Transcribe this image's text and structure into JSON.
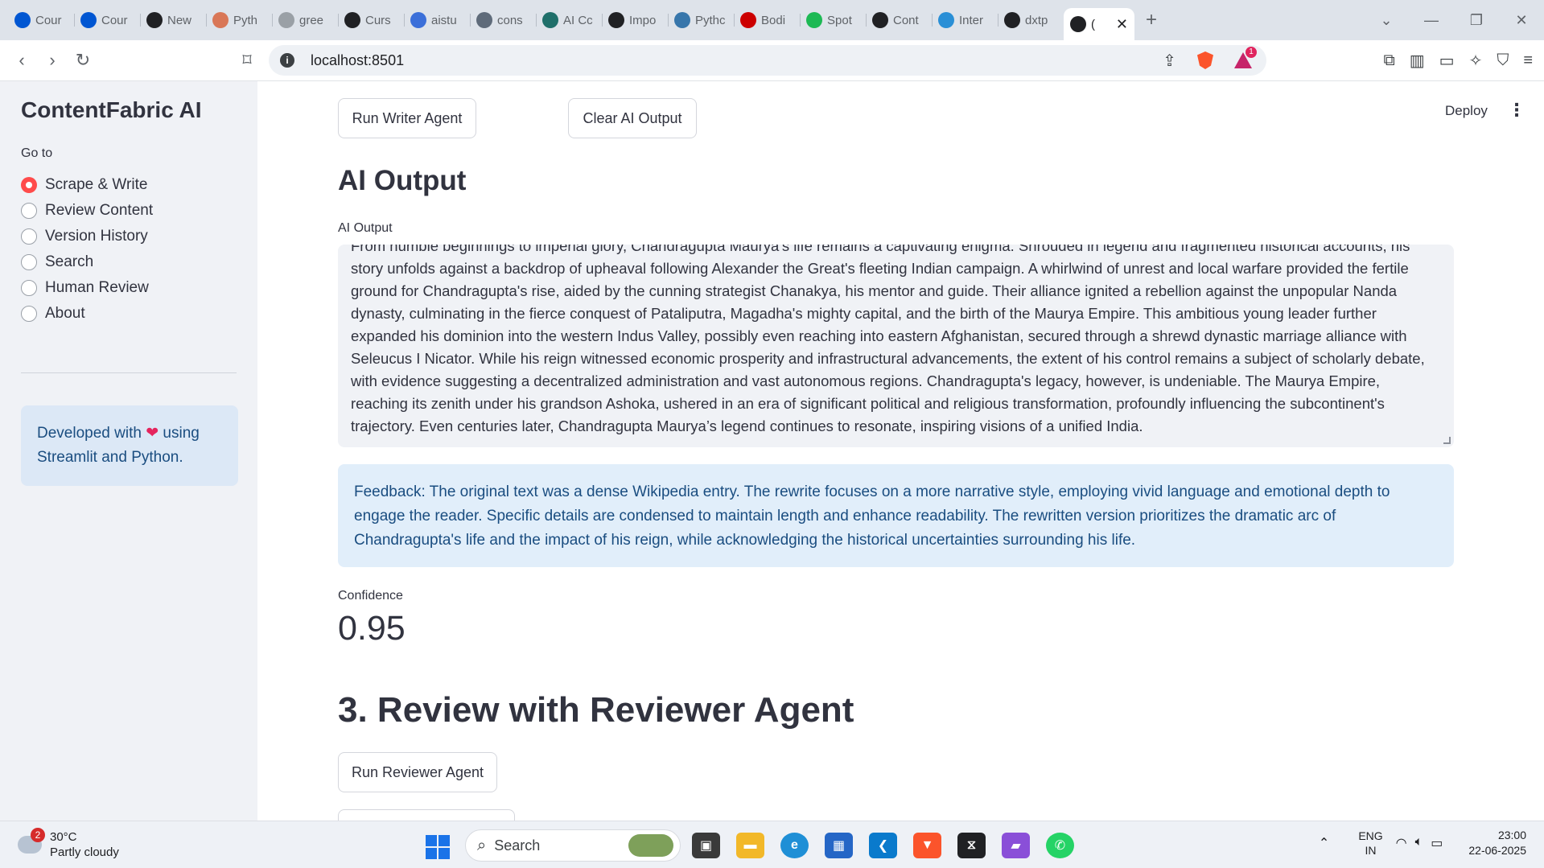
{
  "browser": {
    "tabs": [
      {
        "label": "Cour",
        "icon": "coursera-icon",
        "color": "#0056d2"
      },
      {
        "label": "Cour",
        "icon": "coursera-icon",
        "color": "#0056d2"
      },
      {
        "label": "New",
        "icon": "github-icon",
        "color": "#202124"
      },
      {
        "label": "Pyth",
        "icon": "claude-icon",
        "color": "#d97757"
      },
      {
        "label": "gree",
        "icon": "loading-icon",
        "color": "#9aa0a6"
      },
      {
        "label": "Curs",
        "icon": "cursor-icon",
        "color": "#202124"
      },
      {
        "label": "aistu",
        "icon": "aistudio-icon",
        "color": "#3b6fd9"
      },
      {
        "label": "cons",
        "icon": "api-icon",
        "color": "#5f6b7a"
      },
      {
        "label": "AI Cc",
        "icon": "ai-icon",
        "color": "#1f6f6a"
      },
      {
        "label": "Impo",
        "icon": "openai-icon",
        "color": "#202124"
      },
      {
        "label": "Pythc",
        "icon": "python-icon",
        "color": "#3776ab"
      },
      {
        "label": "Bodi",
        "icon": "cnn-icon",
        "color": "#cc0000"
      },
      {
        "label": "Spot",
        "icon": "spotify-icon",
        "color": "#1db954"
      },
      {
        "label": "Cont",
        "icon": "streamlit-icon",
        "color": "#202124"
      },
      {
        "label": "Inter",
        "icon": "is-icon",
        "color": "#2a8fd6"
      },
      {
        "label": "dxtp",
        "icon": "github-icon",
        "color": "#202124"
      },
      {
        "label": "(",
        "icon": "streamlit-icon",
        "color": "#202124",
        "active": true
      }
    ],
    "url": "localhost:8501"
  },
  "sidebar": {
    "title": "ContentFabric AI",
    "goto_label": "Go to",
    "nav": [
      {
        "label": "Scrape & Write",
        "selected": true
      },
      {
        "label": "Review Content",
        "selected": false
      },
      {
        "label": "Version History",
        "selected": false
      },
      {
        "label": "Search",
        "selected": false
      },
      {
        "label": "Human Review",
        "selected": false
      },
      {
        "label": "About",
        "selected": false
      }
    ],
    "info_prefix": "Developed with",
    "info_suffix": "using Streamlit and Python."
  },
  "header": {
    "deploy": "Deploy"
  },
  "main": {
    "run_writer": "Run Writer Agent",
    "clear_output": "Clear AI Output",
    "output_heading": "AI Output",
    "output_label": "AI Output",
    "output_text": "From humble beginnings to imperial glory, Chandragupta Maurya's life remains a captivating enigma. Shrouded in legend and fragmented historical accounts, his story unfolds against a backdrop of upheaval following Alexander the Great's fleeting Indian campaign.  A whirlwind of unrest and local warfare provided the fertile ground for Chandragupta's rise, aided by the cunning strategist Chanakya, his mentor and guide. Their alliance ignited a rebellion against the unpopular Nanda dynasty, culminating in the fierce conquest of Pataliputra, Magadha's mighty capital, and the birth of the Maurya Empire.  This ambitious young leader further expanded his dominion into the western Indus Valley, possibly even reaching into eastern Afghanistan, secured through a shrewd dynastic marriage alliance with Seleucus I Nicator. While his reign witnessed economic prosperity and infrastructural advancements, the extent of his control remains a subject of scholarly debate, with evidence suggesting a decentralized administration and vast autonomous regions.  Chandragupta's legacy, however, is undeniable. The Maurya Empire, reaching its zenith under his grandson Ashoka, ushered in an era of significant political and religious transformation, profoundly influencing the subcontinent's trajectory. Even centuries later, Chandragupta Maurya’s legend continues to resonate, inspiring visions of a unified India.",
    "feedback": "Feedback: The original text was a dense Wikipedia entry. The rewrite focuses on a more narrative style, employing vivid language and emotional depth to engage the reader. Specific details are condensed to maintain length and enhance readability. The rewritten version prioritizes the dramatic arc of Chandragupta's life and the impact of his reign, while acknowledging the historical uncertainties surrounding his life.",
    "confidence_label": "Confidence",
    "confidence_value": "0.95",
    "review_heading": "3. Review with Reviewer Agent",
    "run_reviewer": "Run Reviewer Agent"
  },
  "taskbar": {
    "weather_badge": "2",
    "temperature": "30°C",
    "condition": "Partly cloudy",
    "search": "Search",
    "lang_top": "ENG",
    "lang_bottom": "IN",
    "time": "23:00",
    "date": "22-06-2025"
  },
  "colors": {
    "accent": "#ff4b4b",
    "info_bg": "#dce8f6",
    "info_text": "#1a4d80"
  }
}
